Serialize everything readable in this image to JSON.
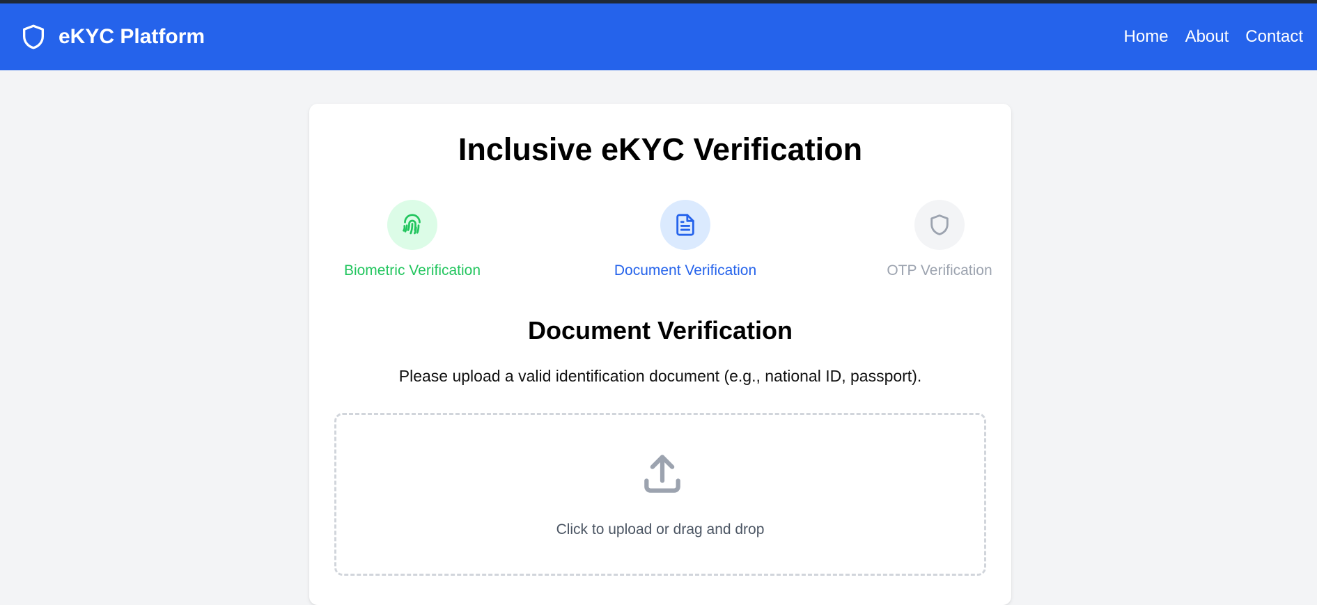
{
  "app": {
    "title": "eKYC Platform",
    "brand_icon": "shield-icon"
  },
  "nav": {
    "links": [
      "Home",
      "About",
      "Contact"
    ]
  },
  "verification": {
    "title": "Inclusive eKYC Verification",
    "steps": [
      {
        "label": "Biometric Verification",
        "icon": "fingerprint-icon",
        "state": "completed",
        "color": "#22c55e",
        "bg": "#dcfce7"
      },
      {
        "label": "Document Verification",
        "icon": "document-icon",
        "state": "active",
        "color": "#2563eb",
        "bg": "#dbeafe"
      },
      {
        "label": "OTP Verification",
        "icon": "shield-icon",
        "state": "pending",
        "color": "#9ca3af",
        "bg": "#f3f4f6"
      }
    ],
    "section": {
      "title": "Document Verification",
      "description": "Please upload a valid identification document (e.g., national ID, passport)."
    },
    "upload": {
      "icon": "upload-icon",
      "text": "Click to upload or drag and drop"
    }
  },
  "colors": {
    "primary": "#2563eb",
    "success": "#22c55e",
    "muted": "#9ca3af",
    "page_bg": "#f3f4f6"
  }
}
